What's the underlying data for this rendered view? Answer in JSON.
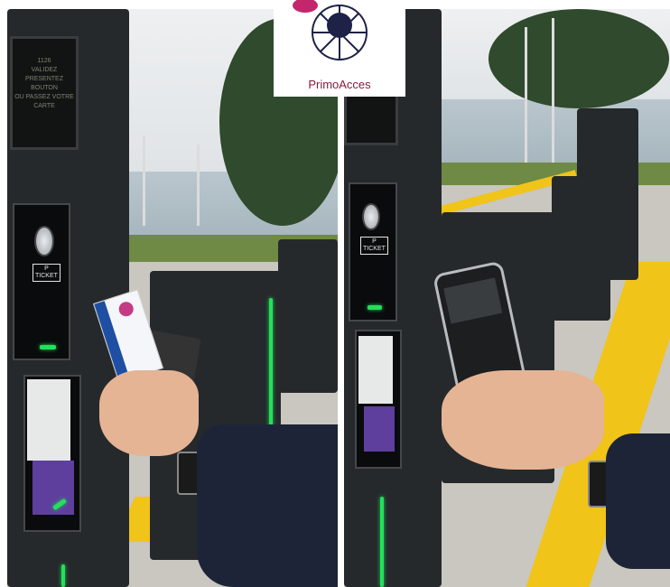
{
  "logo": {
    "name": "PrimoAcces"
  },
  "left_panel": {
    "screen_text": [
      "1126",
      "VALIDEZ",
      "PRESENTEZ",
      "BOUTON",
      "OU PASSEZ VOTRE",
      "CARTE"
    ],
    "ticket_label": "P\nTICKET"
  },
  "right_panel": {
    "ticket_label": "P\nTICKET"
  },
  "colors": {
    "kiosk": "#26292c",
    "led_green": "#22e05a",
    "logo_accent": "#8a1a3d",
    "sticker_purple": "#5e3f9e",
    "curb_yellow": "#f0c419"
  }
}
